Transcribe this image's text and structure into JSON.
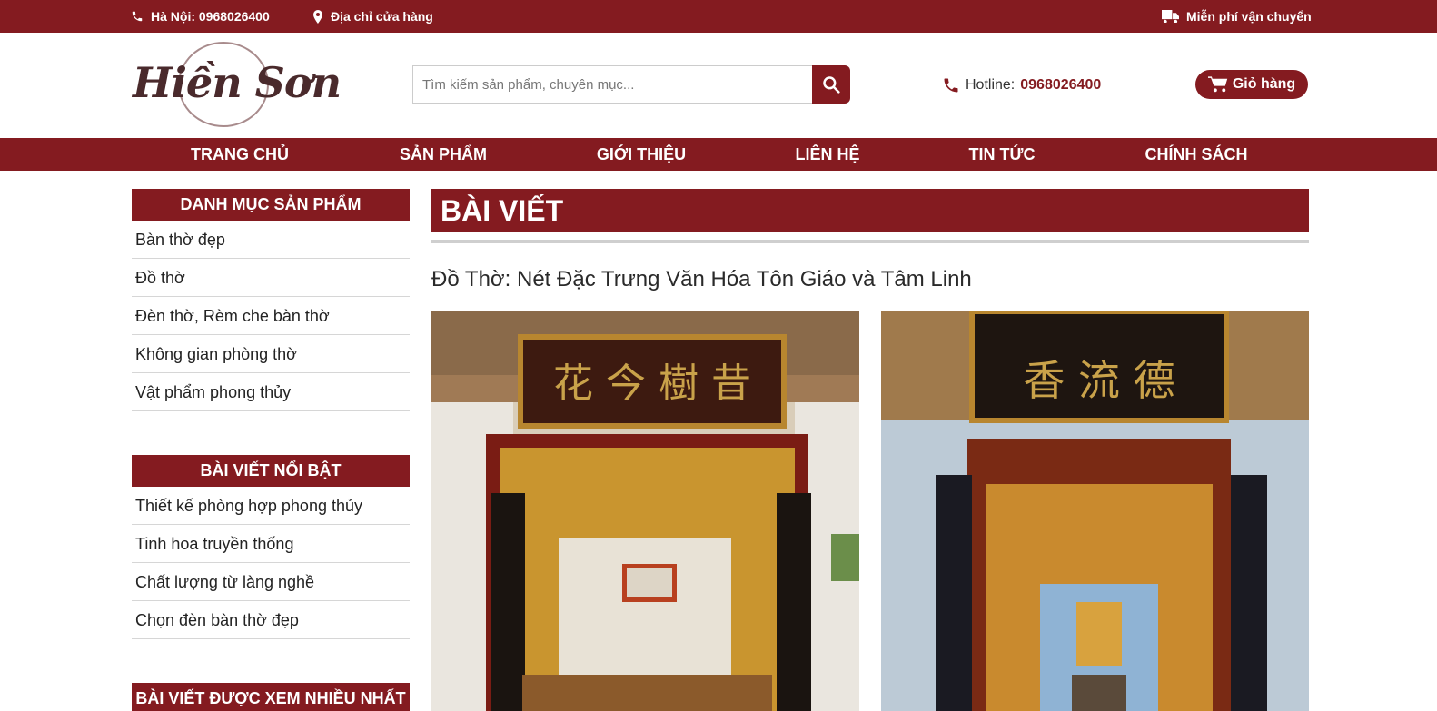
{
  "topbar": {
    "phone": "Hà Nội: 0968026400",
    "address": "Địa chỉ cửa hàng",
    "shipping": "Miễn phí vận chuyển"
  },
  "header": {
    "logo_text": "Hiền Sơn",
    "search_placeholder": "Tìm kiếm sản phẩm, chuyên mục...",
    "hotline_label": "Hotline:",
    "hotline_number": "0968026400",
    "cart_label": "Giỏ hàng"
  },
  "nav": {
    "items": [
      "TRANG CHỦ",
      "SẢN PHẨM",
      "GIỚI THIỆU",
      "LIÊN HỆ",
      "TIN TỨC",
      "CHÍNH SÁCH"
    ]
  },
  "sidebar": {
    "categories_title": "DANH MỤC SẢN PHẨM",
    "categories": [
      "Bàn thờ đẹp",
      "Đồ thờ",
      "Đèn thờ, Rèm che bàn thờ",
      "Không gian phòng thờ",
      "Vật phẩm phong thủy"
    ],
    "featured_title": "BÀI VIẾT NỔI BẬT",
    "featured": [
      "Thiết kế phòng hợp phong thủy",
      "Tinh hoa truyền thống",
      "Chất lượng từ làng nghề",
      "Chọn đèn bàn thờ đẹp"
    ],
    "most_viewed_title": "BÀI VIẾT ĐƯỢC XEM NHIỀU NHẤT"
  },
  "main": {
    "section_title": "BÀI VIẾT",
    "article_title": "Đồ Thờ: Nét Đặc Trưng Văn Hóa Tôn Giáo và Tâm Linh",
    "photo1_plaque": "花 今 樹 昔",
    "photo2_plaque": "香 流 德"
  },
  "colors": {
    "brand": "#841b20",
    "gold": "#c9a24a",
    "wood": "#a0522d"
  }
}
